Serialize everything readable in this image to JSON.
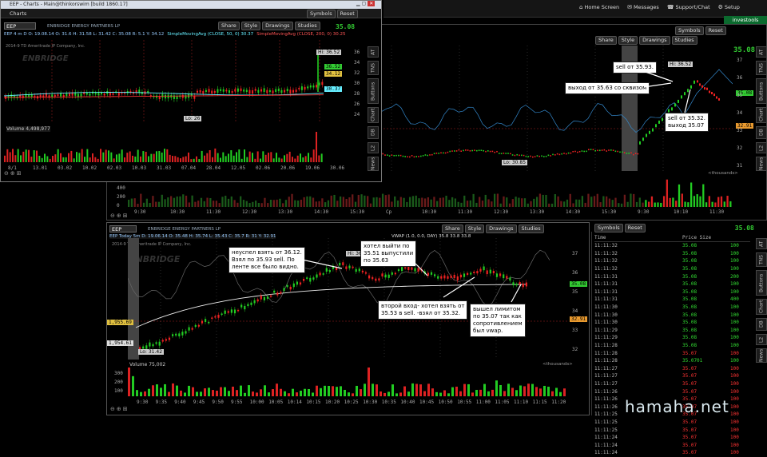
{
  "topbar": {
    "home_screen": "Home Screen",
    "messages": "Messages",
    "support_chat": "Support/Chat",
    "setup": "Setup",
    "investools": "investools"
  },
  "win1": {
    "title": "EEP - Charts - Main@thinkorswim [build 1860.17]",
    "tab": "Charts",
    "symbol": "EEP",
    "symbols_btn": "Symbols",
    "reset_btn": "Reset",
    "price_big": "35.08",
    "company": "ENBRIDGE ENERGY PARTNERS LP",
    "share": "Share",
    "style": "Style",
    "drawings": "Drawings",
    "studies": "Studies",
    "ohlc": "EEP 4 m D  O: 19.08.14  O: 31.6  H: 31.58  L: 31.42  C: 35.08  R: 5.1  Y: 34.12",
    "sma1": "SimpleMovingAvg (CLOSE, 50, 0)  30.37",
    "sma2": "SimpleMovingAvg (CLOSE, 200, 0)  30.25",
    "copyright": "2014-9 TD Ameritrade IP Company, Inc.",
    "logo": "ENBRIDGE",
    "hi": "Hi: 36.52",
    "lo": "Lo: 26",
    "volume": "Volume  4,498,977",
    "x_labels": [
      "8/1",
      "13.01",
      "03.02",
      "10.02",
      "02.03",
      "10.03",
      "31.03",
      "07.04",
      "28.04",
      "12.05",
      "02.06",
      "20.06",
      "19.06",
      "30.06"
    ],
    "y_labels": [
      "36",
      "34",
      "32",
      "30",
      "28",
      "26",
      "24"
    ],
    "tags": [
      "36.52",
      "34.12",
      "30.37"
    ]
  },
  "win2": {
    "share": "Share",
    "style": "Style",
    "drawings": "Drawings",
    "studies": "Studies",
    "symbols_btn": "Symbols",
    "reset_btn": "Reset",
    "price_big": "35.08",
    "lo": "Lo: 30.85",
    "hi": "Hi: 36.52",
    "tag_right": "32.91",
    "tag_price": "35.08",
    "y_labels": [
      "37",
      "36",
      "35",
      "34",
      "33",
      "32",
      "31"
    ],
    "x_labels": [
      "9:30",
      "10:30",
      "11:30",
      "12:30",
      "13:30",
      "14:30",
      "15:30",
      "Cp",
      "10:30",
      "11:30",
      "12:30",
      "13:30",
      "14:30",
      "15:30",
      "9:30",
      "10:10",
      "11:30"
    ],
    "vol_labels": [
      "400",
      "200",
      "0"
    ],
    "thousands": "<thousands>"
  },
  "win3": {
    "symbol": "EEP",
    "company": "ENBRIDGE ENERGY PARTNERS LP",
    "share": "Share",
    "style": "Style",
    "drawings": "Drawings",
    "studies": "Studies",
    "symbols_btn": "Symbols",
    "reset_btn": "Reset",
    "price_big": "35.08",
    "ohlc": "EEP Today 5m  D: 19.06.14  O: 35.48  H: 35.74  L: 35.43  C: 35.7  R: 31  Y: 32.91",
    "vwap": "VWAP (1.0, 0.0, DAY)  35.8  33.8  33.8",
    "copyright": "2014-9 TD Ameritrade IP Company, Inc.",
    "logo": "ENBRIDGE",
    "hi": "Hi: 36.52",
    "lo": "Lo: 31.42",
    "tag_left1": "1,955.69",
    "tag_left2": "1,954.61",
    "tag_right1": "32.91",
    "tag_price": "35.08",
    "y_labels": [
      "37",
      "36",
      "35",
      "34",
      "33",
      "32"
    ],
    "x_labels": [
      "9:30",
      "9:35",
      "9:40",
      "9:45",
      "9:50",
      "9:55",
      "10:00",
      "10:05",
      "10:14",
      "10:15",
      "10:20",
      "10:25",
      "10:30",
      "10:35",
      "10:40",
      "10:45",
      "10:50",
      "10:55",
      "11:00",
      "11:05",
      "11:10",
      "11:15",
      "11:20"
    ],
    "volume": "Volume  75,002",
    "vol_labels": [
      "300",
      "200",
      "100"
    ],
    "thousands": "<thousands>"
  },
  "time_sales": {
    "header_time": "Time",
    "header_price": "Price  Size",
    "rows": [
      {
        "t": "11:11:32",
        "p": "35.08",
        "s": "100",
        "c": "green"
      },
      {
        "t": "11:11:32",
        "p": "35.08",
        "s": "100",
        "c": "green"
      },
      {
        "t": "11:11:32",
        "p": "35.08",
        "s": "100",
        "c": "green"
      },
      {
        "t": "11:11:32",
        "p": "35.08",
        "s": "100",
        "c": "green"
      },
      {
        "t": "11:11:31",
        "p": "35.08",
        "s": "200",
        "c": "green"
      },
      {
        "t": "11:11:31",
        "p": "35.08",
        "s": "100",
        "c": "green"
      },
      {
        "t": "11:11:31",
        "p": "35.08",
        "s": "100",
        "c": "green"
      },
      {
        "t": "11:11:31",
        "p": "35.08",
        "s": "400",
        "c": "green"
      },
      {
        "t": "11:11:30",
        "p": "35.08",
        "s": "100",
        "c": "green"
      },
      {
        "t": "11:11:30",
        "p": "35.08",
        "s": "100",
        "c": "green"
      },
      {
        "t": "11:11:30",
        "p": "35.08",
        "s": "100",
        "c": "green"
      },
      {
        "t": "11:11:29",
        "p": "35.08",
        "s": "100",
        "c": "green"
      },
      {
        "t": "11:11:29",
        "p": "35.08",
        "s": "100",
        "c": "green"
      },
      {
        "t": "11:11:28",
        "p": "35.08",
        "s": "100",
        "c": "green"
      },
      {
        "t": "11:11:28",
        "p": "35.07",
        "s": "100",
        "c": "red"
      },
      {
        "t": "11:11:28",
        "p": "35.0701",
        "s": "100",
        "c": "green"
      },
      {
        "t": "11:11:27",
        "p": "35.07",
        "s": "100",
        "c": "red"
      },
      {
        "t": "11:11:27",
        "p": "35.07",
        "s": "100",
        "c": "red"
      },
      {
        "t": "11:11:27",
        "p": "35.07",
        "s": "100",
        "c": "red"
      },
      {
        "t": "11:11:26",
        "p": "35.07",
        "s": "100",
        "c": "red"
      },
      {
        "t": "11:11:26",
        "p": "35.07",
        "s": "100",
        "c": "red"
      },
      {
        "t": "11:11:26",
        "p": "35.07",
        "s": "100",
        "c": "red"
      },
      {
        "t": "11:11:25",
        "p": "35.07",
        "s": "100",
        "c": "red"
      },
      {
        "t": "11:11:25",
        "p": "35.07",
        "s": "100",
        "c": "red"
      },
      {
        "t": "11:11:25",
        "p": "35.07",
        "s": "100",
        "c": "red"
      },
      {
        "t": "11:11:24",
        "p": "35.07",
        "s": "100",
        "c": "red"
      },
      {
        "t": "11:11:24",
        "p": "35.07",
        "s": "100",
        "c": "red"
      },
      {
        "t": "11:11:24",
        "p": "35.07",
        "s": "100",
        "c": "red"
      }
    ]
  },
  "notes": {
    "sell": "sell от 35.93.",
    "exit_squeeze": "выход от 35.63 со сквизом",
    "sell_exit": "sell от 35.32.\nвыход 35.07",
    "missed": "неуспел взять от 36.12.\nВзял по 35.93 sell. По\nленте все было видно.",
    "wanted_exit": "хотел выйти по\n35.51 выпустили\nпо 35.63",
    "second_entry": "второй вход- хотел взять от\n35.53 в sell. -взял от 35.32.",
    "exit_limit": "вышел лимитом\nпо 35.07 так как\nсопротивлением\nбыл vwap."
  },
  "side_tabs": [
    "AT",
    "TNS",
    "Buttons",
    "Chart",
    "DB",
    "L2",
    "News"
  ],
  "watermark": "hamaha.net"
}
